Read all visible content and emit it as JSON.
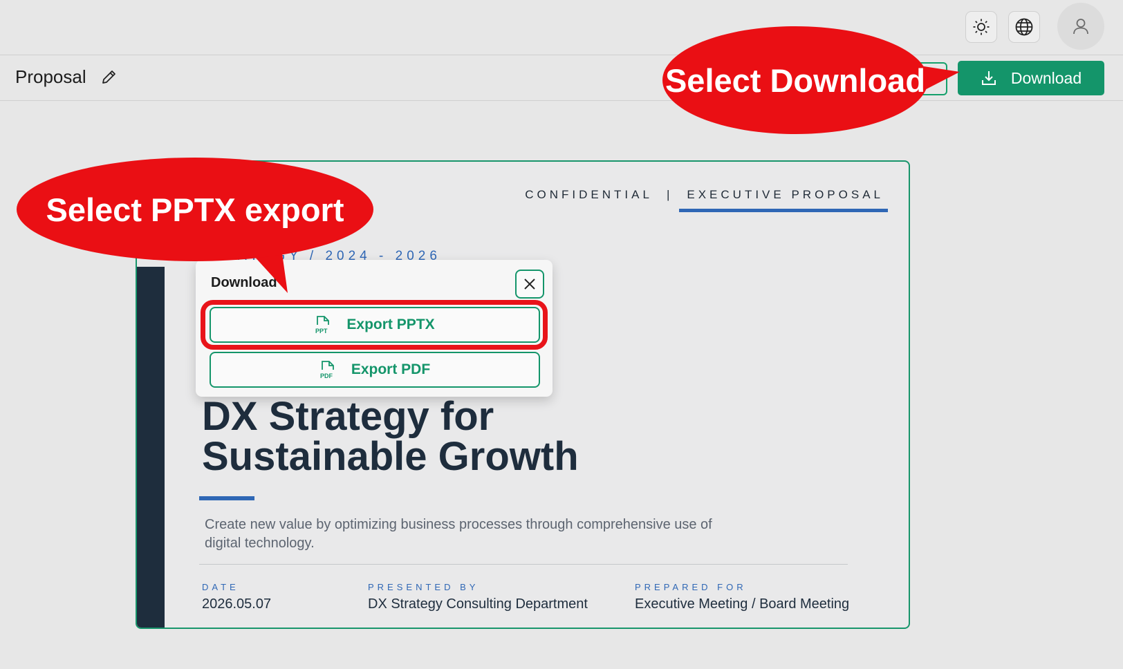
{
  "header": {
    "theme_icon": "sun-icon",
    "language_icon": "globe-icon",
    "avatar_icon": "user-icon"
  },
  "document": {
    "title": "Proposal",
    "edit_icon": "pencil-icon",
    "download_label": "Download",
    "download_icon": "download-icon"
  },
  "slide": {
    "tag_left": "CONFIDENTIAL",
    "tag_separator": "|",
    "tag_right": "EXECUTIVE PROPOSAL",
    "kicker": "STRATEGY / 2024 - 2026",
    "title_line1": "DX Strategy for",
    "title_line2": "Sustainable Growth",
    "description": "Create new value by optimizing business processes through comprehensive use of digital technology.",
    "meta": [
      {
        "label": "DATE",
        "value": "2026.05.07"
      },
      {
        "label": "PRESENTED BY",
        "value": "DX Strategy Consulting Department"
      },
      {
        "label": "PREPARED FOR",
        "value": "Executive Meeting / Board Meeting"
      }
    ]
  },
  "popup": {
    "title": "Download",
    "close_icon": "close-icon",
    "export_pptx": "Export PPTX",
    "export_pdf": "Export PDF",
    "pptx_icon": "ppt-file-icon",
    "pdf_icon": "pdf-file-icon"
  },
  "annotations": {
    "download": "Select Download",
    "pptx": "Select PPTX export",
    "color": "#ea0f14"
  },
  "colors": {
    "accent": "#14956a",
    "slide_blue": "#2f67b5",
    "slide_dark": "#1e2d3d"
  }
}
